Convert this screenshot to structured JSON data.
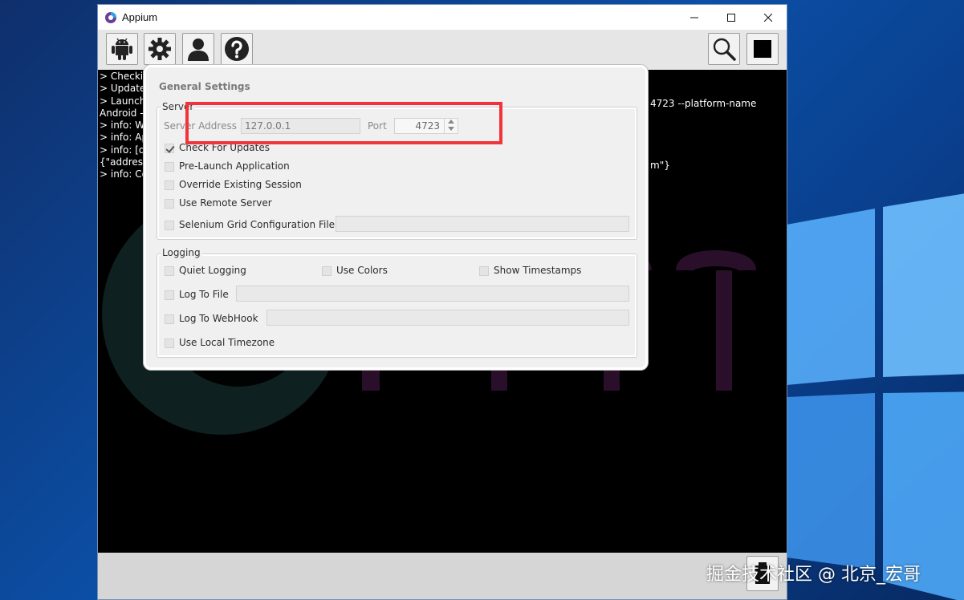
{
  "window": {
    "title": "Appium"
  },
  "toolbar": {
    "buttons": [
      "android-icon",
      "gear-icon",
      "user-icon",
      "help-icon",
      "search-icon",
      "stop-icon"
    ]
  },
  "console": {
    "lines": [
      "> Checkin",
      "> Update",
      "> Launchi",
      "Android -",
      "> info: W",
      "> info: Ap",
      "> info: [de",
      "{\"address",
      "> info: Co"
    ],
    "right_fragments": [
      "4723 --platform-name",
      "m\"}"
    ]
  },
  "dialog": {
    "title": "General Settings",
    "server": {
      "group_label": "Server",
      "address_label": "Server Address",
      "address_value": "127.0.0.1",
      "port_label": "Port",
      "port_value": "4723",
      "options": [
        {
          "label": "Check For Updates",
          "checked": true
        },
        {
          "label": "Pre-Launch Application",
          "checked": false
        },
        {
          "label": "Override Existing Session",
          "checked": false
        },
        {
          "label": "Use Remote Server",
          "checked": false
        },
        {
          "label": "Selenium Grid Configuration File",
          "checked": false
        }
      ]
    },
    "logging": {
      "group_label": "Logging",
      "quiet_logging": "Quiet Logging",
      "use_colors": "Use Colors",
      "show_timestamps": "Show Timestamps",
      "log_to_file": "Log To File",
      "log_to_webhook": "Log To WebHook",
      "use_local_timezone": "Use Local Timezone"
    }
  },
  "watermark": "掘金技术社区 @ 北京_宏哥",
  "colors": {
    "highlight": "#f0343a",
    "console_bg": "#000000"
  }
}
